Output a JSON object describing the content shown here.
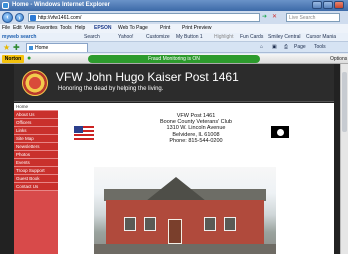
{
  "window": {
    "title": "Home - Windows Internet Explorer"
  },
  "address_bar": {
    "url": "http://vfw1461.com/",
    "search_placeholder": "Live Search"
  },
  "menu": [
    "File",
    "Edit",
    "View",
    "Favorites",
    "Tools",
    "Help"
  ],
  "epson": {
    "brand": "EPSON",
    "web_to_page": "Web To Page",
    "print": "Print",
    "print_preview": "Print Preview"
  },
  "toolbar2": {
    "brand": "myweb search",
    "search": "Search",
    "smiley": "Smiley Central",
    "favs": "Fun Cards",
    "yahoo": "Yahoo!",
    "customize": "Customize",
    "my_button": "My Button 1",
    "highlight": "Highlight",
    "cursor": "Cursor Mania"
  },
  "tab": {
    "label": "Home",
    "page": "Page",
    "tools": "Tools"
  },
  "norton": {
    "logo": "Norton",
    "status": "Fraud Monitoring is ON",
    "options": "Options"
  },
  "site": {
    "title": "VFW John Hugo Kaiser Post 1461",
    "subtitle": "Honoring the dead by helping the living.",
    "nav": [
      "Home",
      "About Us",
      "Officers",
      "Links",
      "Site Map",
      "Newsletters",
      "Photos",
      "Events",
      "Troop Support",
      "Guest Book",
      "Contact Us"
    ],
    "address": [
      "VFW Post 1461",
      "Boone County Veterans' Club",
      "1310 W. Lincoln Avenue",
      "Belvidere, IL  61008",
      "Phone: 815-544-0200"
    ]
  }
}
